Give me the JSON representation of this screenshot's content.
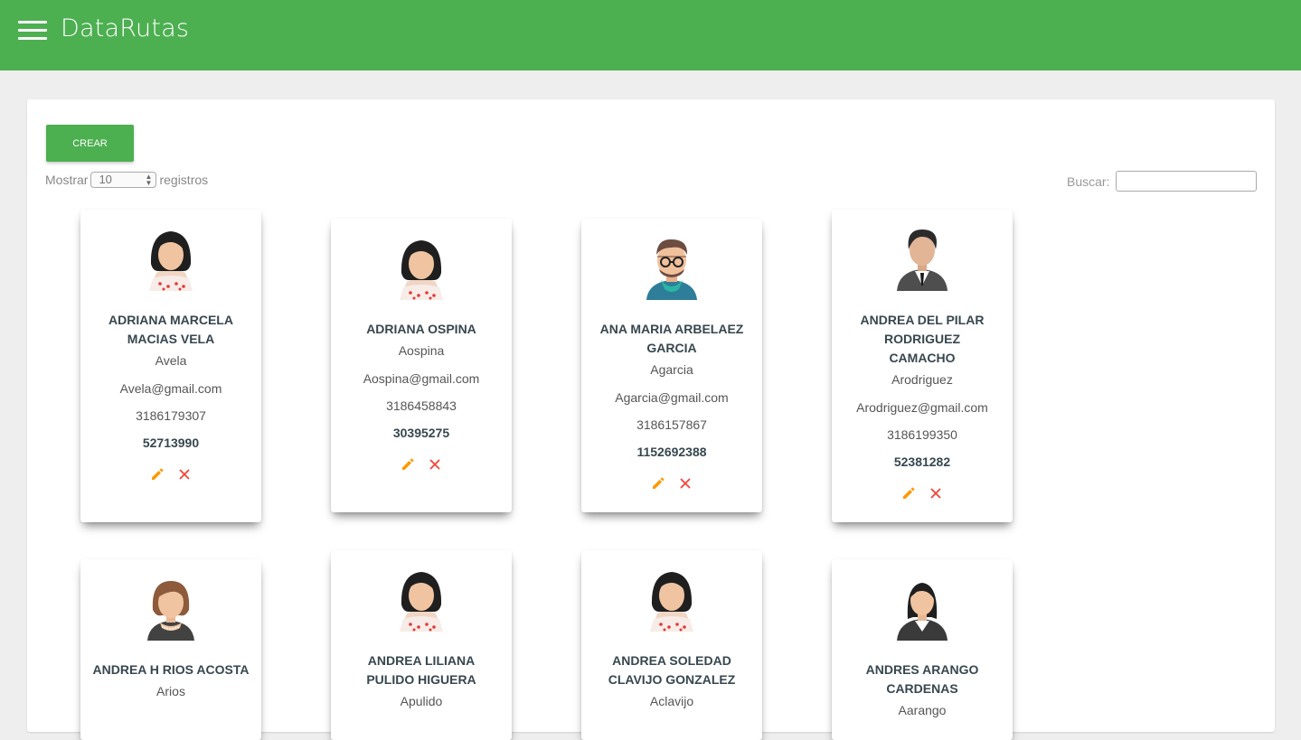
{
  "app": {
    "title": "DataRutas"
  },
  "toolbar": {
    "create_label": "CREAR"
  },
  "length": {
    "prefix": "Mostrar",
    "value": "10",
    "suffix": "registros"
  },
  "search": {
    "label": "Buscar:",
    "value": ""
  },
  "colors": {
    "header": "#4caf50",
    "edit_icon": "#ff9800",
    "delete_icon": "#f44336"
  },
  "cards": [
    {
      "name": "ADRIANA MARCELA MACIAS VELA",
      "user": "Avela",
      "email": "Avela@gmail.com",
      "phone": "3186179307",
      "doc": "52713990",
      "avatar": "woman-avatar-icon"
    },
    {
      "name": "ADRIANA OSPINA",
      "user": "Aospina",
      "email": "Aospina@gmail.com",
      "phone": "3186458843",
      "doc": "30395275",
      "avatar": "woman-avatar-icon"
    },
    {
      "name": "ANA MARIA ARBELAEZ GARCIA",
      "user": "Agarcia",
      "email": "Agarcia@gmail.com",
      "phone": "3186157867",
      "doc": "1152692388",
      "avatar": "man-glasses-avatar-icon"
    },
    {
      "name": "ANDREA DEL PILAR RODRIGUEZ CAMACHO",
      "user": "Arodriguez",
      "email": "Arodriguez@gmail.com",
      "phone": "3186199350",
      "doc": "52381282",
      "avatar": "businessman-avatar-icon"
    },
    {
      "name": "ANDREA H RIOS ACOSTA",
      "user": "Arios",
      "email": "",
      "phone": "",
      "doc": "",
      "avatar": "woman-brown-hair-avatar-icon"
    },
    {
      "name": "ANDREA LILIANA PULIDO HIGUERA",
      "user": "Apulido",
      "email": "",
      "phone": "",
      "doc": "",
      "avatar": "woman-avatar-icon"
    },
    {
      "name": "ANDREA SOLEDAD CLAVIJO GONZALEZ",
      "user": "Aclavijo",
      "email": "",
      "phone": "",
      "doc": "",
      "avatar": "woman-avatar-icon"
    },
    {
      "name": "ANDRES ARANGO CARDENAS",
      "user": "Aarango",
      "email": "",
      "phone": "",
      "doc": "",
      "avatar": "businesswoman-avatar-icon"
    }
  ]
}
